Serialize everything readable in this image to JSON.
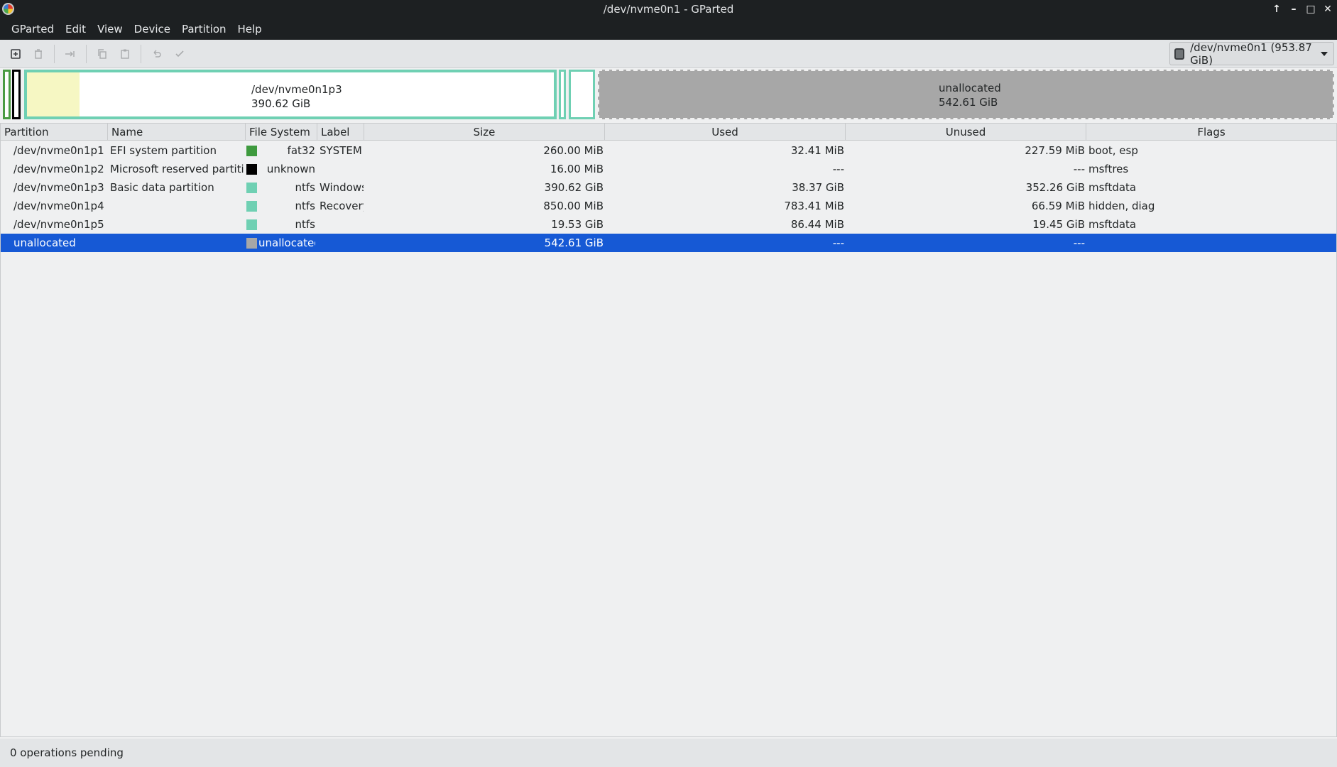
{
  "window": {
    "title": "/dev/nvme0n1 - GParted"
  },
  "menu": [
    "GParted",
    "Edit",
    "View",
    "Device",
    "Partition",
    "Help"
  ],
  "device_selector": {
    "value": "/dev/nvme0n1 (953.87 GiB)"
  },
  "diskmap": {
    "p3_name": "/dev/nvme0n1p3",
    "p3_size": "390.62 GiB",
    "unalloc_name": "unallocated",
    "unalloc_size": "542.61 GiB"
  },
  "columns": [
    "Partition",
    "Name",
    "File System",
    "Label",
    "Size",
    "Used",
    "Unused",
    "Flags"
  ],
  "colors": {
    "fat32": "#3e9a3e",
    "unknown": "#000000",
    "ntfs": "#6fd0b3",
    "unallocated": "#a7a7a7",
    "selection": "#1659d5"
  },
  "rows": [
    {
      "partition": "/dev/nvme0n1p1",
      "warn": false,
      "name": "EFI system partition",
      "fs": "fat32",
      "fs_color": "#3e9a3e",
      "label": "SYSTEM",
      "size": "260.00 MiB",
      "used": "32.41 MiB",
      "unused": "227.59 MiB",
      "flags": "boot, esp",
      "selected": false
    },
    {
      "partition": "/dev/nvme0n1p2",
      "warn": true,
      "name": "Microsoft reserved partition",
      "fs": "unknown",
      "fs_color": "#000000",
      "label": "",
      "size": "16.00 MiB",
      "used": "---",
      "unused": "---",
      "flags": "msftres",
      "selected": false
    },
    {
      "partition": "/dev/nvme0n1p3",
      "warn": false,
      "name": "Basic data partition",
      "fs": "ntfs",
      "fs_color": "#6fd0b3",
      "label": "Windows",
      "size": "390.62 GiB",
      "used": "38.37 GiB",
      "unused": "352.26 GiB",
      "flags": "msftdata",
      "selected": false
    },
    {
      "partition": "/dev/nvme0n1p4",
      "warn": true,
      "name": "",
      "fs": "ntfs",
      "fs_color": "#6fd0b3",
      "label": "Recovery",
      "size": "850.00 MiB",
      "used": "783.41 MiB",
      "unused": "66.59 MiB",
      "flags": "hidden, diag",
      "selected": false
    },
    {
      "partition": "/dev/nvme0n1p5",
      "warn": false,
      "name": "",
      "fs": "ntfs",
      "fs_color": "#6fd0b3",
      "label": "",
      "size": "19.53 GiB",
      "used": "86.44 MiB",
      "unused": "19.45 GiB",
      "flags": "msftdata",
      "selected": false
    },
    {
      "partition": "unallocated",
      "warn": false,
      "name": "",
      "fs": "unallocated",
      "fs_color": "#a7a7a7",
      "label": "",
      "size": "542.61 GiB",
      "used": "---",
      "unused": "---",
      "flags": "",
      "selected": true
    }
  ],
  "status": {
    "text": "0 operations pending"
  }
}
